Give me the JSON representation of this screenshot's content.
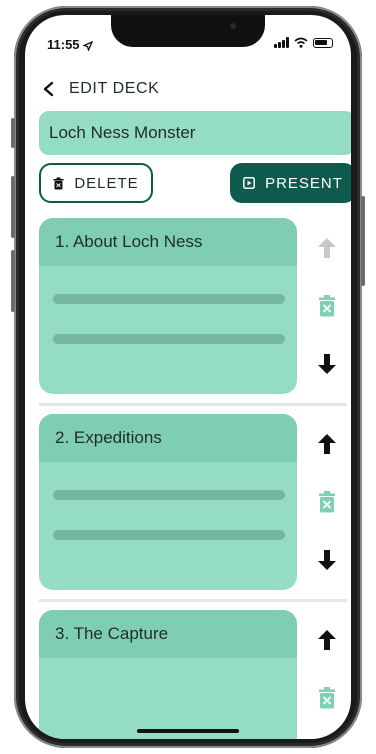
{
  "status": {
    "time": "11:55"
  },
  "header": {
    "title": "EDIT DECK"
  },
  "deck": {
    "name": "Loch Ness Monster"
  },
  "actions": {
    "delete_label": "DELETE",
    "present_label": "PRESENT"
  },
  "slides": [
    {
      "title": "1. About Loch Ness",
      "move_up_enabled": false,
      "move_down_enabled": true
    },
    {
      "title": "2. Expeditions",
      "move_up_enabled": true,
      "move_down_enabled": true
    },
    {
      "title": "3. The Capture",
      "move_up_enabled": true,
      "move_down_enabled": true
    }
  ],
  "colors": {
    "accent_dark": "#0e5a4c",
    "card": "#94dcc6",
    "card_header": "#7fcdb4",
    "placeholder_line": "#74b6a0",
    "trash_icon": "#7fd1b6",
    "disabled_arrow": "#c8c8c8"
  },
  "icons": {
    "back": "chevron-left-icon",
    "delete": "trash-icon",
    "present": "play-square-icon",
    "move_up": "arrow-up-icon",
    "move_down": "arrow-down-icon"
  }
}
